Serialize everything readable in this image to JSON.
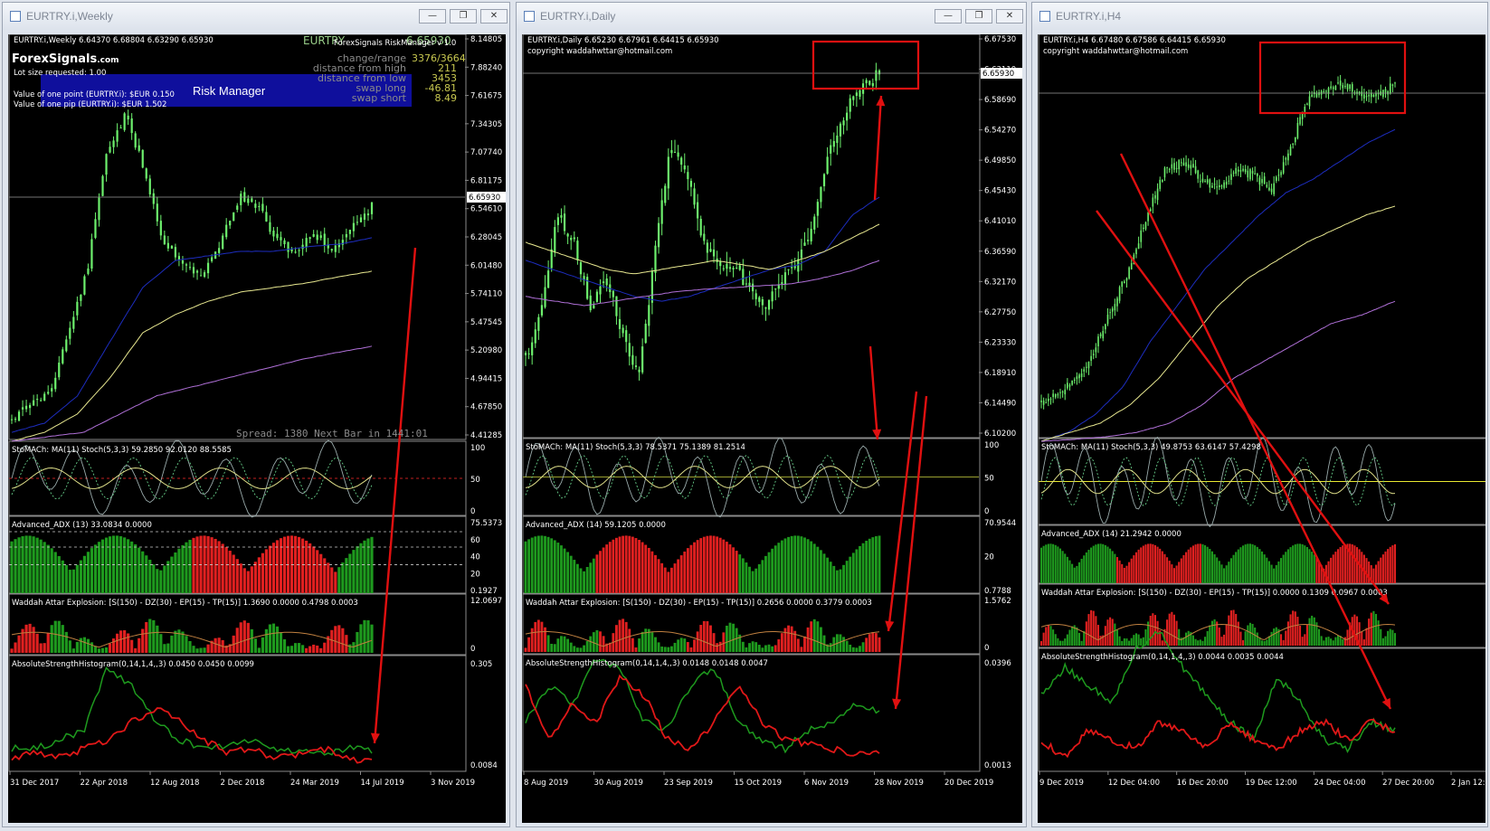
{
  "windows": [
    {
      "title": "EURTRY.i,Weekly",
      "header": "EURTRY.i,Weekly  6.64370 6.68804 6.63290 6.65930",
      "price_axis": [
        "8.14805",
        "7.88240",
        "7.61675",
        "7.34305",
        "7.07740",
        "6.81175",
        "6.54610",
        "6.28045",
        "6.01480",
        "5.74110",
        "5.47545",
        "5.20980",
        "4.94415",
        "4.67850",
        "4.41285"
      ],
      "current_price": "6.65930",
      "date_axis": [
        "31 Dec 2017",
        "22 Apr 2018",
        "12 Aug 2018",
        "2 Dec 2018",
        "24 Mar 2019",
        "14 Jul 2019",
        "3 Nov 2019"
      ],
      "stoch_label": "StoMACh: MA(11)  Stoch(5,3,3) 59.2850 92.0120 88.5585",
      "stoch_axis": [
        "100",
        "50",
        "0"
      ],
      "adx_label": "Advanced_ADX (13) 33.0834 0.0000",
      "adx_axis": [
        "75.5373",
        "60",
        "40",
        "20",
        "0.1927"
      ],
      "waddah_label": "Waddah Attar Explosion: [S(150) - DZ(30) - EP(15) - TP(15)] 1.3690 0.0000 0.4798 0.0003",
      "waddah_axis": [
        "12.0697",
        "0"
      ],
      "ash_label": "AbsoluteStrengthHistogram(0,14,1,4,,3) 0.0450 0.0450 0.0099",
      "ash_axis": [
        "0.305",
        "0.0084"
      ]
    },
    {
      "title": "EURTRY.i,Daily",
      "header": "EURTRY.i,Daily  6.65230 6.67961 6.64415 6.65930",
      "copyright": "copyright waddahwttar@hotmail.com",
      "price_axis": [
        "6.67530",
        "6.63110",
        "6.58690",
        "6.54270",
        "6.49850",
        "6.45430",
        "6.41010",
        "6.36590",
        "6.32170",
        "6.27750",
        "6.23330",
        "6.18910",
        "6.14490",
        "6.10200"
      ],
      "current_price": "6.65930",
      "date_axis": [
        "8 Aug 2019",
        "30 Aug 2019",
        "23 Sep 2019",
        "15 Oct 2019",
        "6 Nov 2019",
        "28 Nov 2019",
        "20 Dec 2019"
      ],
      "stoch_label": "StoMACh: MA(11)  Stoch(5,3,3) 78.5371 75.1389 81.2514",
      "stoch_axis": [
        "100",
        "50",
        "0"
      ],
      "adx_label": "Advanced_ADX (14) 59.1205 0.0000",
      "adx_axis": [
        "70.9544",
        "20",
        "0.7788"
      ],
      "waddah_label": "Waddah Attar Explosion: [S(150) - DZ(30) - EP(15) - TP(15)] 0.2656 0.0000 0.3779 0.0003",
      "waddah_axis": [
        "1.5762",
        "0"
      ],
      "ash_label": "AbsoluteStrengthHistogram(0,14,1,4,,3) 0.0148 0.0148 0.0047",
      "ash_axis": [
        "0.0396",
        "0.0013"
      ]
    },
    {
      "title": "EURTRY.i,H4",
      "header": "EURTRY.i,H4  6.67480 6.67586 6.64415 6.65930",
      "copyright": "copyright waddahwttar@hotmail.com",
      "date_axis": [
        "9 Dec 2019",
        "12 Dec 04:00",
        "16 Dec 20:00",
        "19 Dec 12:00",
        "24 Dec 04:00",
        "27 Dec 20:00",
        "2 Jan 12:00"
      ],
      "stoch_label": "StoMACh: MA(11)  Stoch(5,3,3) 49.8753 63.6147 57.4298",
      "adx_label": "Advanced_ADX (14) 21.2942 0.0000",
      "waddah_label": "Waddah Attar Explosion: [S(150) - DZ(30) - EP(15) - TP(15)] 0.0000 0.1309 0.0967 0.0003",
      "ash_label": "AbsoluteStrengthHistogram(0,14,1,4,,3) 0.0044 0.0035 0.0044"
    }
  ],
  "weekly_panel": {
    "logo": "ForexSignals",
    "logo_suffix": ".com",
    "lot_size": "Lot size requested: 1.00",
    "point_value": "Value of one point (EURTRY.i):  $EUR 0.150",
    "pip_value": "Value of one pip    (EURTRY.i):  $EUR 1.502",
    "risk_manager": "Risk Manager",
    "symbol_big": "EURTRY",
    "symbol_price": "6.65930",
    "rm_header": "ForexSignals RiskManager v 1.0",
    "rows": [
      {
        "label": "change/range",
        "value": "3376/3664"
      },
      {
        "label": "distance from high",
        "value": "211"
      },
      {
        "label": "distance from low",
        "value": "3453"
      },
      {
        "label": "swap long",
        "value": "-46.81"
      },
      {
        "label": "swap short",
        "value": "8.49"
      }
    ],
    "spread_text": "Spread: 1380 Next Bar in 1441:01"
  },
  "window_buttons": {
    "minimize": "—",
    "restore": "❐",
    "close": "✕"
  },
  "colors": {
    "candle": "#6df06d",
    "ma_blue": "#1d2dbf",
    "ma_yellow": "#e8e890",
    "ma_purple": "#b070d8",
    "bar_green": "#1e9a1e",
    "bar_red": "#e02020",
    "arrow": "#e01010"
  }
}
